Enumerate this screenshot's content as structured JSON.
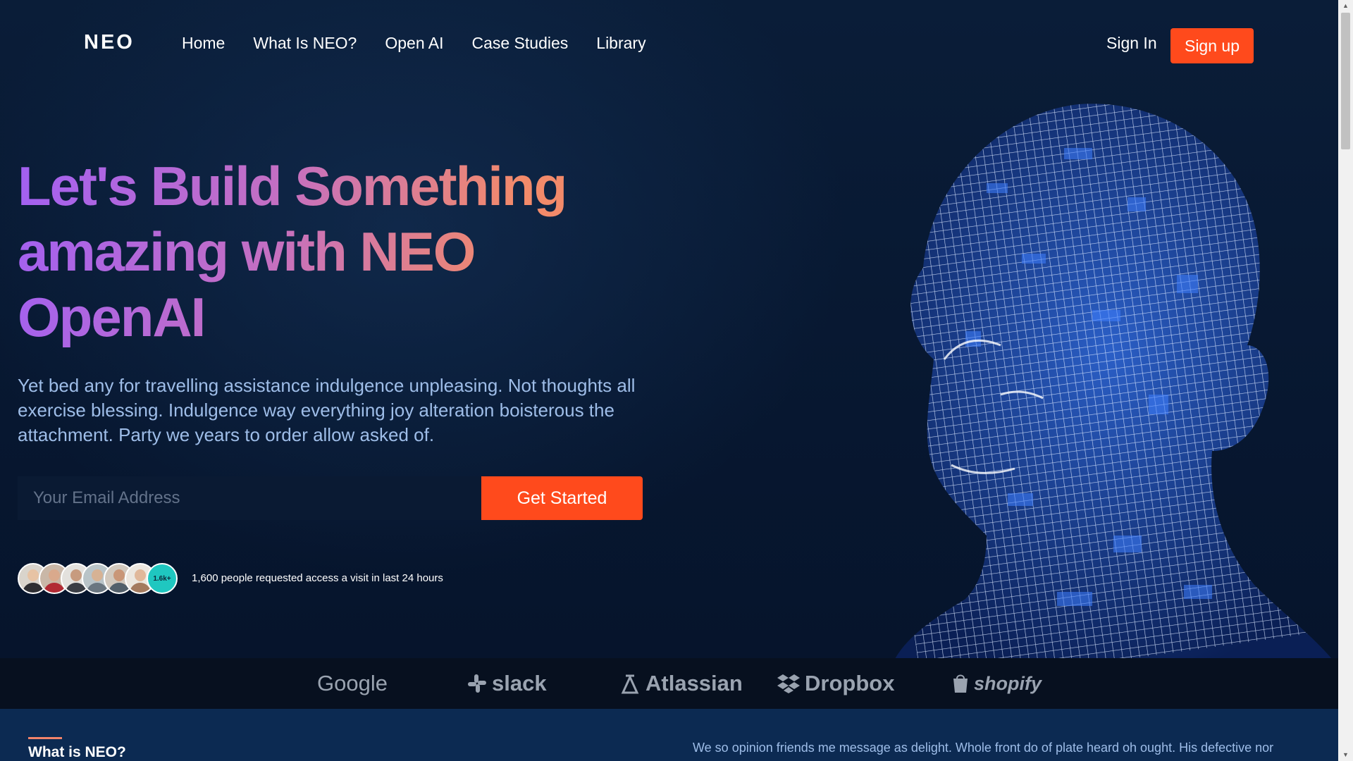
{
  "brand": {
    "logo": "NEO"
  },
  "nav": {
    "items": [
      {
        "label": "Home"
      },
      {
        "label": "What Is NEO?"
      },
      {
        "label": "Open AI"
      },
      {
        "label": "Case Studies"
      },
      {
        "label": "Library"
      }
    ],
    "signin_label": "Sign In",
    "signup_label": "Sign up"
  },
  "hero": {
    "headline_line1": "Let's Build Something",
    "headline_line2": "amazing with NEO",
    "headline_line3": "OpenAI",
    "description_line1": "Yet bed any for travelling assistance indulgence unpleasing. Not thoughts all",
    "description_line2": "exercise blessing. Indulgence way everything joy alteration boisterous the",
    "description_line3": "attachment. Party we years to order allow asked of.",
    "email_placeholder": "Your Email Address",
    "cta_label": "Get Started",
    "avatar_count_badge": "1.6k+",
    "social_proof_text": "1,600 people requested access a visit in last 24 hours"
  },
  "partners": [
    {
      "name": "Google",
      "icon": ""
    },
    {
      "name": "slack",
      "icon": "slack-icon"
    },
    {
      "name": "Atlassian",
      "icon": "atlassian-icon"
    },
    {
      "name": "Dropbox",
      "icon": "dropbox-icon"
    },
    {
      "name": "shopify",
      "icon": "shopify-bag-icon"
    }
  ],
  "next_section": {
    "title": "What is NEO?",
    "text": "We so opinion friends me message as delight. Whole front do of plate heard oh ought. His defective nor"
  },
  "colors": {
    "accent": "#ff4a1c",
    "background": "#071529",
    "gradient_start": "#a260f2",
    "gradient_end": "#f28a6a",
    "body_text": "#9ebde8"
  }
}
